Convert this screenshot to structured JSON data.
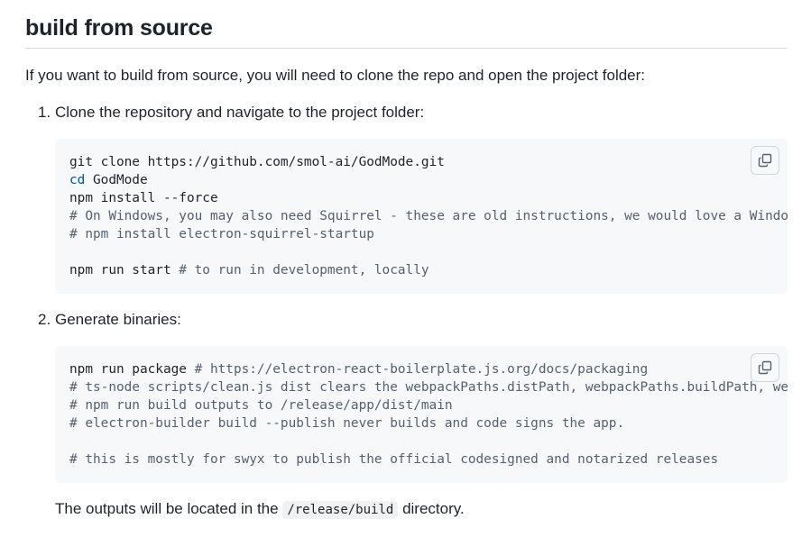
{
  "heading": "build from source",
  "intro": "If you want to build from source, you will need to clone the repo and open the project folder:",
  "steps": [
    {
      "number": "1.",
      "title": "Clone the repository and navigate to the project folder:",
      "code": {
        "line1": "git clone https://github.com/smol-ai/GodMode.git",
        "line2_kw": "cd",
        "line2_rest": " GodMode",
        "line3": "npm install --force",
        "line4": "# On Windows, you may also need Squirrel - these are old instructions, we would love a Windows volunteer to help",
        "line5": "# npm install electron-squirrel-startup",
        "line6": "",
        "line7_cmd": "npm run start ",
        "line7_comment": "# to run in development, locally"
      },
      "copy_icon": "copy-icon"
    },
    {
      "number": "2.",
      "title": "Generate binaries:",
      "code": {
        "line1_cmd": "npm run package ",
        "line1_comment": "# https://electron-react-boilerplate.js.org/docs/packaging",
        "line2": "# ts-node scripts/clean.js dist clears the webpackPaths.distPath, webpackPaths.buildPath, webpackPaths.dllPath",
        "line3": "# npm run build outputs to /release/app/dist/main",
        "line4": "# electron-builder build --publish never builds and code signs the app.",
        "line5": "",
        "line6": "# this is mostly for swyx to publish the official codesigned and notarized releases"
      },
      "copy_icon": "copy-icon"
    }
  ],
  "outro": {
    "before": "The outputs will be located in the ",
    "code": "/release/build",
    "after": " directory."
  },
  "colors": {
    "text": "#1f2328",
    "code_bg": "#f6f8fa",
    "keyword": "#0550ae",
    "comment": "#57606a",
    "rule": "#d8dee4"
  }
}
